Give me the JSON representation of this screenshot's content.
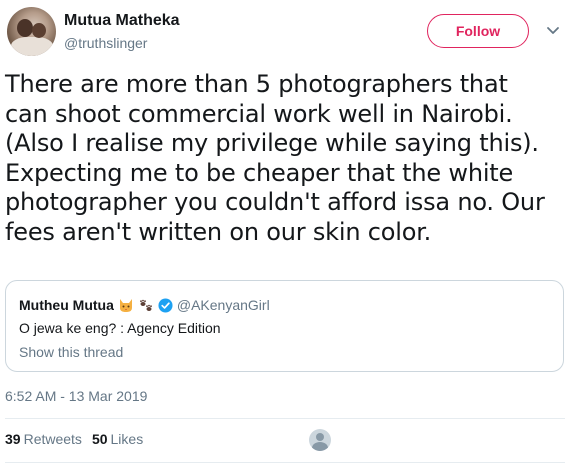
{
  "author": {
    "name": "Mutua Matheka",
    "handle": "@truthslinger"
  },
  "follow_label": "Follow",
  "tweet_text": "There are more than 5 photographers that\ncan shoot commercial work well in Nairobi.\n(Also I realise my privilege while saying this).\nExpecting me to be cheaper that the white\nphotographer you couldn't afford issa no. Our\nfees aren't written on our skin color.",
  "quote": {
    "name": "Mutheu Mutua",
    "handle": "@AKenyanGirl",
    "text": "O jewa ke eng? : Agency Edition",
    "show_thread": "Show this thread"
  },
  "timestamp": "6:52 AM - 13 Mar 2019",
  "stats": {
    "retweets_count": "39",
    "retweets_label": "Retweets",
    "likes_count": "50",
    "likes_label": "Likes"
  },
  "colors": {
    "accent": "#e0245e",
    "verified": "#1da1f2",
    "secondary_text": "#657786",
    "border": "#ccd6dd"
  },
  "icons": [
    "caret-down-icon",
    "cat-emoji-icon",
    "paw-prints-emoji-icon",
    "verified-badge-icon"
  ]
}
